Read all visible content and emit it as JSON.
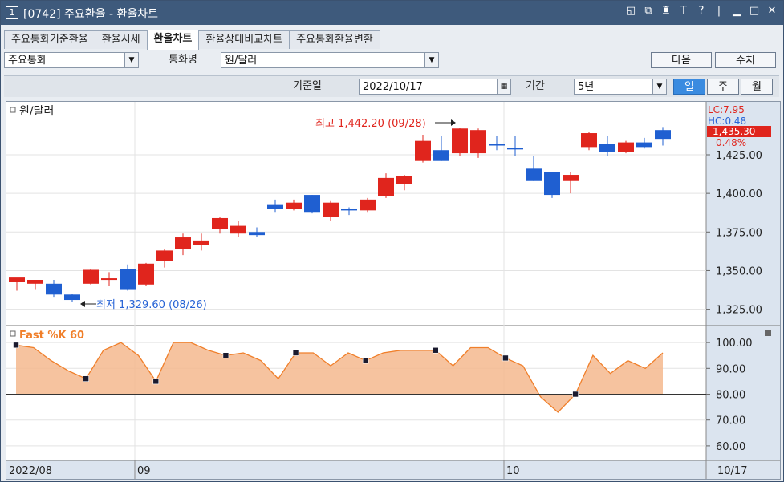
{
  "window": {
    "number": "1",
    "title": "[0742] 주요환율 - 환율차트",
    "icons": [
      "window-restore-icon",
      "copy-icon",
      "stamp-icon",
      "text-icon",
      "help-icon",
      "minimize-icon",
      "maximize-icon",
      "close-icon"
    ]
  },
  "tabs": [
    {
      "label": "주요통화기준환율",
      "active": false
    },
    {
      "label": "환율시세",
      "active": false
    },
    {
      "label": "환율차트",
      "active": true
    },
    {
      "label": "환율상대비교차트",
      "active": false
    },
    {
      "label": "주요통화환율변환",
      "active": false
    }
  ],
  "controls": {
    "category_value": "주요통화",
    "currency_label": "통화명",
    "currency_value": "원/달러",
    "next_label": "다음",
    "value_label": "수치",
    "base_date_label": "기준일",
    "base_date_value": "2022/10/17",
    "period_label": "기간",
    "period_value": "5년",
    "day_label": "일",
    "week_label": "주",
    "month_label": "월"
  },
  "chart_data": [
    {
      "type": "candlestick",
      "title": "원/달러",
      "ylim": [
        1317,
        1452
      ],
      "yticks": [
        "1,425.00",
        "1,400.00",
        "1,375.00",
        "1,350.00",
        "1,325.00"
      ],
      "ytick_values": [
        1425,
        1400,
        1375,
        1350,
        1325
      ],
      "right_labels": {
        "lc": "LC:7.95",
        "hc": "HC:0.48",
        "price": "1,435.30",
        "pct": "0.48%"
      },
      "high_annotation": "최고 1,442.20 (09/28)",
      "low_annotation": "최저 1,329.60 (08/26)",
      "x_labels": [
        "2022/08",
        "09",
        "10",
        "10/17"
      ],
      "candles": [
        {
          "o": 1342.5,
          "h": 1345,
          "l": 1337,
          "c": 1345.5,
          "up": true
        },
        {
          "o": 1341.5,
          "h": 1344,
          "l": 1338,
          "c": 1344,
          "up": true
        },
        {
          "o": 1341.5,
          "h": 1344,
          "l": 1333,
          "c": 1334.5,
          "up": false
        },
        {
          "o": 1334.5,
          "h": 1335,
          "l": 1329.6,
          "c": 1331,
          "up": false
        },
        {
          "o": 1341.5,
          "h": 1351,
          "l": 1341,
          "c": 1350.5,
          "up": true
        },
        {
          "o": 1344,
          "h": 1349,
          "l": 1340,
          "c": 1345,
          "up": true
        },
        {
          "o": 1351,
          "h": 1354,
          "l": 1337,
          "c": 1338,
          "up": false
        },
        {
          "o": 1341,
          "h": 1355,
          "l": 1340,
          "c": 1354.5,
          "up": true
        },
        {
          "o": 1356,
          "h": 1364,
          "l": 1352,
          "c": 1363,
          "up": true
        },
        {
          "o": 1364,
          "h": 1374,
          "l": 1360,
          "c": 1371.5,
          "up": true
        },
        {
          "o": 1366.5,
          "h": 1374,
          "l": 1363,
          "c": 1369.5,
          "up": true
        },
        {
          "o": 1377,
          "h": 1385,
          "l": 1374,
          "c": 1384,
          "up": true
        },
        {
          "o": 1374,
          "h": 1382,
          "l": 1372,
          "c": 1379,
          "up": true
        },
        {
          "o": 1375,
          "h": 1378,
          "l": 1372,
          "c": 1373,
          "up": false
        },
        {
          "o": 1393,
          "h": 1396,
          "l": 1388,
          "c": 1390,
          "up": false
        },
        {
          "o": 1390,
          "h": 1396,
          "l": 1389,
          "c": 1394,
          "up": true
        },
        {
          "o": 1399,
          "h": 1399,
          "l": 1387,
          "c": 1388,
          "up": false
        },
        {
          "o": 1385,
          "h": 1395,
          "l": 1382,
          "c": 1394,
          "up": true
        },
        {
          "o": 1390,
          "h": 1391,
          "l": 1386,
          "c": 1390,
          "up": false
        },
        {
          "o": 1389,
          "h": 1397,
          "l": 1388,
          "c": 1396,
          "up": true
        },
        {
          "o": 1398,
          "h": 1413,
          "l": 1397,
          "c": 1410,
          "up": true
        },
        {
          "o": 1406,
          "h": 1412,
          "l": 1402,
          "c": 1411,
          "up": true
        },
        {
          "o": 1421,
          "h": 1438,
          "l": 1420,
          "c": 1434,
          "up": true
        },
        {
          "o": 1428,
          "h": 1437,
          "l": 1421,
          "c": 1421,
          "up": false
        },
        {
          "o": 1426,
          "h": 1442.2,
          "l": 1424,
          "c": 1442,
          "up": true
        },
        {
          "o": 1426,
          "h": 1442,
          "l": 1423,
          "c": 1441,
          "up": true
        },
        {
          "o": 1432,
          "h": 1437,
          "l": 1428,
          "c": 1432,
          "up": false
        },
        {
          "o": 1429.5,
          "h": 1437,
          "l": 1424,
          "c": 1429.5,
          "up": false
        },
        {
          "o": 1416,
          "h": 1424,
          "l": 1408,
          "c": 1408,
          "up": false
        },
        {
          "o": 1414,
          "h": 1414,
          "l": 1397,
          "c": 1399,
          "up": false
        },
        {
          "o": 1408,
          "h": 1414,
          "l": 1400,
          "c": 1412,
          "up": true
        },
        {
          "o": 1430,
          "h": 1440,
          "l": 1428,
          "c": 1439,
          "up": true
        },
        {
          "o": 1432,
          "h": 1437,
          "l": 1424,
          "c": 1427,
          "up": false
        },
        {
          "o": 1427,
          "h": 1434,
          "l": 1426,
          "c": 1433,
          "up": true
        },
        {
          "o": 1433,
          "h": 1436,
          "l": 1429,
          "c": 1430,
          "up": false
        },
        {
          "o": 1441,
          "h": 1443,
          "l": 1431,
          "c": 1435.3,
          "up": false
        }
      ]
    },
    {
      "type": "area",
      "title": "Fast %K 60",
      "ylim": [
        55,
        105
      ],
      "yticks": [
        "100.00",
        "90.00",
        "80.00",
        "70.00",
        "60.00"
      ],
      "ytick_values": [
        100,
        90,
        80,
        70,
        60
      ],
      "baseline": 80,
      "values": [
        99,
        98,
        93,
        89,
        86,
        97,
        100,
        95,
        85,
        100,
        100,
        97,
        95,
        96,
        93,
        86,
        96,
        96,
        91,
        96,
        93,
        96,
        97,
        97,
        97,
        91,
        98,
        98,
        94,
        91,
        79,
        73,
        80,
        95,
        88,
        93,
        90,
        96
      ],
      "markers": [
        0,
        4,
        8,
        12,
        16,
        20,
        24,
        28,
        32
      ]
    }
  ]
}
